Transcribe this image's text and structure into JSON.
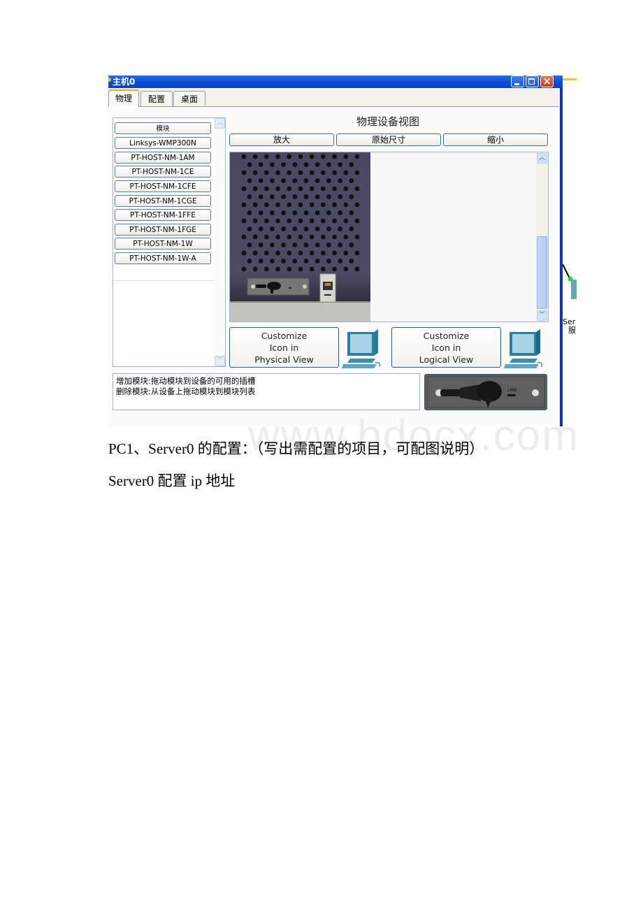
{
  "window": {
    "title": "主机0",
    "controls": {
      "minimize": "minimize",
      "maximize": "maximize",
      "close": "×"
    }
  },
  "tabs": [
    {
      "label": "物理",
      "active": true
    },
    {
      "label": "配置",
      "active": false
    },
    {
      "label": "桌面",
      "active": false
    }
  ],
  "module_list": {
    "header": "模块",
    "items": [
      "Linksys-WMP300N",
      "PT-HOST-NM-1AM",
      "PT-HOST-NM-1CE",
      "PT-HOST-NM-1CFE",
      "PT-HOST-NM-1CGE",
      "PT-HOST-NM-1FFE",
      "PT-HOST-NM-1FGE",
      "PT-HOST-NM-1W",
      "PT-HOST-NM-1W-A"
    ]
  },
  "physical_view": {
    "title": "物理设备视图",
    "zoom_in": "放大",
    "original_size": "原始尺寸",
    "zoom_out": "缩小"
  },
  "customize": {
    "physical": [
      "Customize",
      "Icon in",
      "Physical View"
    ],
    "logical": [
      "Customize",
      "Icon in",
      "Logical View"
    ]
  },
  "info": {
    "line1": "增加模块:拖动模块到设备的可用的插槽",
    "line2": "删除模块:从设备上拖动模块到模块列表"
  },
  "module_preview": {
    "link_label": "LINK"
  },
  "topology": {
    "label_line1": "Ser",
    "label_line2": "服"
  },
  "document": {
    "line1": "PC1、Server0 的配置：（写出需配置的项目，可配图说明）",
    "line2": "Server0 配置 ip 地址",
    "watermark": "www.bdocx.com"
  },
  "colors": {
    "titlebar": "#0a4fd6",
    "device_body": "#4b4860",
    "button_border": "#2f5a92"
  }
}
